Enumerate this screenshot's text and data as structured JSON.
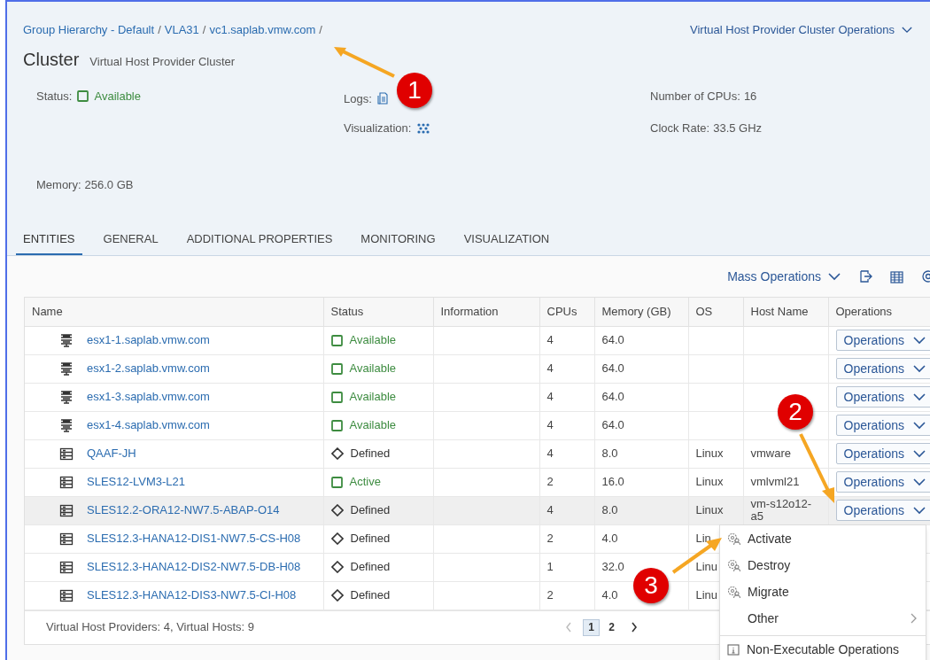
{
  "breadcrumb": [
    {
      "label": "Group Hierarchy - Default",
      "separator": "/"
    },
    {
      "label": "VLA31",
      "separator": "/"
    },
    {
      "label": "vc1.saplab.vmw.com",
      "separator": "/"
    }
  ],
  "header_action": "Virtual Host Provider Cluster Operations",
  "title": "Cluster",
  "subtitle": "Virtual Host Provider Cluster",
  "fields": [
    {
      "kind": "status",
      "label": "Status:",
      "value": "Available"
    },
    {
      "kind": "logs",
      "label": "Logs:"
    },
    {
      "kind": "text",
      "label": "Number of CPUs:",
      "value": "16"
    },
    {
      "kind": "graph",
      "label": "Visualization:"
    },
    {
      "kind": "text",
      "label": "Clock Rate:",
      "value": "33.5 GHz"
    },
    {
      "kind": "text",
      "label": "Memory:",
      "value": "256.0 GB"
    }
  ],
  "tabs": [
    {
      "label": "ENTITIES",
      "selected": true
    },
    {
      "label": "GENERAL",
      "selected": false
    },
    {
      "label": "ADDITIONAL PROPERTIES",
      "selected": false
    },
    {
      "label": "MONITORING",
      "selected": false
    },
    {
      "label": "VISUALIZATION",
      "selected": false
    }
  ],
  "toolbar": {
    "mass_operations": "Mass Operations"
  },
  "table": {
    "columns": [
      "Name",
      "Status",
      "Information",
      "CPUs",
      "Memory (GB)",
      "OS",
      "Host Name",
      "Operations"
    ],
    "rows": [
      {
        "kind": "host",
        "name": "esx1-1.saplab.vmw.com",
        "status": "Available",
        "defined": false,
        "cpus": "4",
        "memory": "64.0",
        "operations": "Operations",
        "hovered": false
      },
      {
        "kind": "host",
        "name": "esx1-2.saplab.vmw.com",
        "status": "Available",
        "defined": false,
        "cpus": "4",
        "memory": "64.0",
        "operations": "Operations",
        "hovered": false
      },
      {
        "kind": "host",
        "name": "esx1-3.saplab.vmw.com",
        "status": "Available",
        "defined": false,
        "cpus": "4",
        "memory": "64.0",
        "operations": "Operations",
        "hovered": false
      },
      {
        "kind": "host",
        "name": "esx1-4.saplab.vmw.com",
        "status": "Available",
        "defined": false,
        "cpus": "4",
        "memory": "64.0",
        "operations": "Operations",
        "hovered": false
      },
      {
        "kind": "vm",
        "name": "QAAF-JH",
        "status": "Defined",
        "defined": true,
        "cpus": "4",
        "memory": "8.0",
        "os": "Linux",
        "host_name": "vmware",
        "operations": "Operations",
        "hovered": false
      },
      {
        "kind": "vm",
        "name": "SLES12-LVM3-L21",
        "status": "Active",
        "defined": false,
        "cpus": "2",
        "memory": "16.0",
        "os": "Linux",
        "host_name": "vmlvml21",
        "operations": "Operations",
        "hovered": false
      },
      {
        "kind": "vm",
        "name": "SLES12.2-ORA12-NW7.5-ABAP-O14",
        "status": "Defined",
        "defined": true,
        "cpus": "4",
        "memory": "8.0",
        "os": "Linux",
        "host_name": "vm-s12o12-a5",
        "operations": "Operations",
        "hovered": true
      },
      {
        "kind": "vm",
        "name": "SLES12.3-HANA12-DIS1-NW7.5-CS-H08",
        "status": "Defined",
        "defined": true,
        "cpus": "2",
        "memory": "4.0",
        "os": "Lin",
        "hovered": false
      },
      {
        "kind": "vm",
        "name": "SLES12.3-HANA12-DIS2-NW7.5-DB-H08",
        "status": "Defined",
        "defined": true,
        "cpus": "1",
        "memory": "32.0",
        "os": "Linu",
        "hovered": false
      },
      {
        "kind": "vm",
        "name": "SLES12.3-HANA12-DIS3-NW7.5-CI-H08",
        "status": "Defined",
        "defined": true,
        "cpus": "2",
        "memory": "4.0",
        "os": "Linu",
        "hovered": false
      }
    ],
    "footer": "Virtual Host Providers: 4, Virtual Hosts: 9",
    "pages": [
      {
        "label": "1",
        "selected": true
      },
      {
        "label": "2",
        "selected": false
      }
    ]
  },
  "menu": [
    {
      "kind": "action",
      "label": "Activate"
    },
    {
      "kind": "action",
      "label": "Destroy"
    },
    {
      "kind": "action",
      "label": "Migrate"
    },
    {
      "kind": "submenu",
      "label": "Other"
    },
    {
      "kind": "info",
      "label": "Non-Executable Operations"
    }
  ],
  "callouts": [
    {
      "number": "1"
    },
    {
      "number": "2"
    },
    {
      "number": "3"
    }
  ]
}
